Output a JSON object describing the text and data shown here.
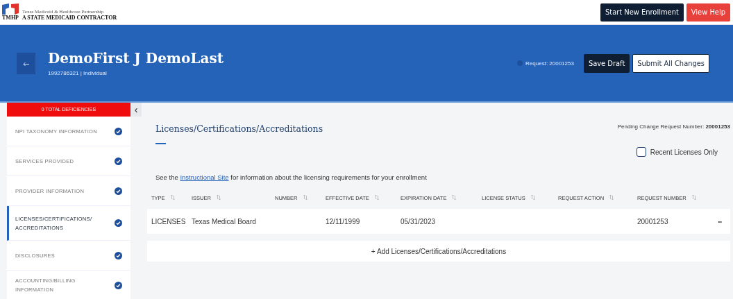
{
  "logo": {
    "tagline": "Texas Medicaid & Healthcare Partnership",
    "wordmark": "TMHP",
    "subtitle": "A STATE MEDICAID CONTRACTOR"
  },
  "top_buttons": [
    {
      "label": "Start New Enrollment",
      "kind": "dark"
    },
    {
      "label": "View Help",
      "kind": "danger"
    }
  ],
  "banner": {
    "name": "DemoFirst J DemoLast",
    "npi": "1992786321",
    "separator": "|",
    "type": "Individual",
    "request": "Request: 20001253",
    "buttons": [
      {
        "label": "Save Draft",
        "kind": "dark"
      },
      {
        "label": "Submit All Changes",
        "kind": "light"
      }
    ]
  },
  "sidebar": {
    "deficiencies": "0 TOTAL DEFICIENCIES",
    "items": [
      {
        "label": "NPI TAXONOMY INFORMATION",
        "selected": false,
        "complete": true
      },
      {
        "label": "SERVICES PROVIDED",
        "selected": false,
        "complete": true
      },
      {
        "label": "PROVIDER INFORMATION",
        "selected": false,
        "complete": true
      },
      {
        "label": "LICENSES/CERTIFICATIONS/ ACCREDITATIONS",
        "selected": true,
        "complete": true
      },
      {
        "label": "DISCLOSURES",
        "selected": false,
        "complete": true
      },
      {
        "label": "ACCOUNTING/BILLING INFORMATION",
        "selected": false,
        "complete": true
      }
    ]
  },
  "collapse": "‹",
  "section": {
    "title": "Licenses/Certifications/Accreditations",
    "pending_label": "Pending Change Request Number:",
    "pending_number": "20001253",
    "recent_only": {
      "label": "Recent Licenses Only",
      "checked": false
    },
    "info": {
      "before": "See the",
      "link": "Instructional Site",
      "after": "for information about the licensing requirements for your enrollment"
    }
  },
  "table": {
    "columns": [
      "TYPE",
      "ISSUER",
      "NUMBER",
      "EFFECTIVE DATE",
      "EXPIRATION DATE",
      "LICENSE STATUS",
      "REQUEST ACTION",
      "REQUEST NUMBER"
    ],
    "rows": [
      {
        "cells": [
          "LICENSES",
          "Texas Medical Board",
          "",
          "12/11/1999",
          "05/31/2023",
          "",
          "",
          "20001253"
        ],
        "menu": "••"
      }
    ],
    "add": "+ Add Licenses/Certifications/Accreditations"
  }
}
